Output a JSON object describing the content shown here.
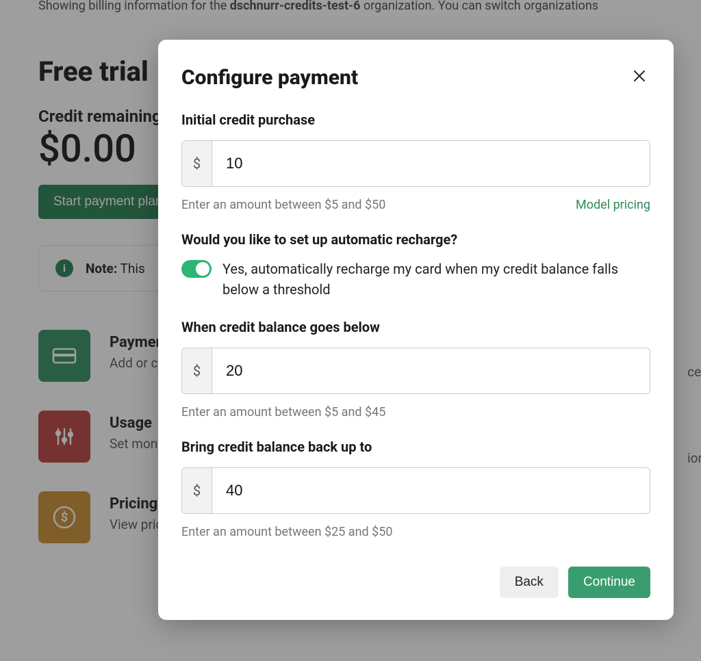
{
  "background": {
    "context_prefix": "Showing billing information for the ",
    "org_name": "dschnurr-credits-test-6",
    "context_suffix": " organization. You can switch organizations",
    "heading": "Free trial",
    "credit_label": "Credit remaining",
    "credit_amount": "$0.00",
    "start_button": "Start payment plan",
    "note_strong": "Note:",
    "note_text": " This",
    "cards": [
      {
        "title": "Payment",
        "subtitle": "Add or change payment method"
      },
      {
        "title": "Usage",
        "subtitle": "Set monthly usage limits and notification"
      },
      {
        "title": "Pricing",
        "subtitle": "View pricing"
      }
    ],
    "right_fragments": {
      "line1": "ces",
      "line2": "ion"
    }
  },
  "modal": {
    "title": "Configure payment",
    "initial_label": "Initial credit purchase",
    "initial_value": "10",
    "initial_hint": "Enter an amount between $5 and $50",
    "pricing_link": "Model pricing",
    "recharge_question": "Would you like to set up automatic recharge?",
    "recharge_toggle_label": "Yes, automatically recharge my card when my credit balance falls below a threshold",
    "below_label": "When credit balance goes below",
    "below_value": "20",
    "below_hint": "Enter an amount between $5 and $45",
    "topup_label": "Bring credit balance back up to",
    "topup_value": "40",
    "topup_hint": "Enter an amount between $25 and $50",
    "back_button": "Back",
    "continue_button": "Continue",
    "dollar_sign": "$"
  }
}
